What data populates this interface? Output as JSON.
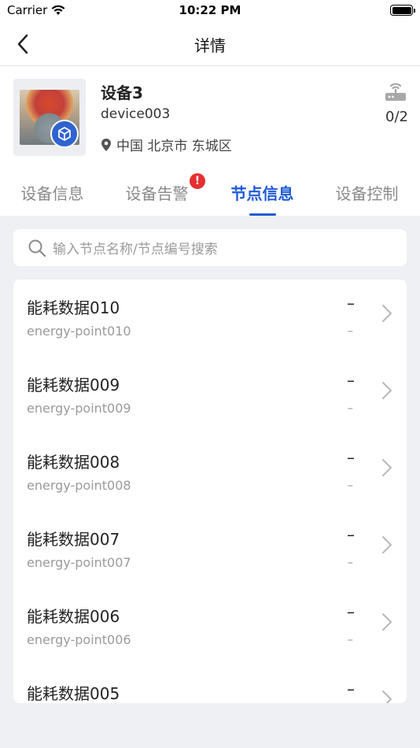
{
  "status_bar": {
    "carrier": "Carrier",
    "time": "10:22 PM"
  },
  "nav": {
    "title": "详情"
  },
  "device": {
    "name": "设备3",
    "code": "device003",
    "location": "中国 北京市 东城区",
    "node_count": "0/2"
  },
  "tabs": [
    {
      "label": "设备信息",
      "active": false
    },
    {
      "label": "设备告警",
      "active": false,
      "badge": "!"
    },
    {
      "label": "节点信息",
      "active": true
    },
    {
      "label": "设备控制",
      "active": false
    }
  ],
  "search": {
    "placeholder": "输入节点名称/节点编号搜索"
  },
  "nodes": [
    {
      "name": "能耗数据010",
      "code": "energy-point010",
      "value": "–",
      "unit": "–"
    },
    {
      "name": "能耗数据009",
      "code": "energy-point009",
      "value": "–",
      "unit": "–"
    },
    {
      "name": "能耗数据008",
      "code": "energy-point008",
      "value": "–",
      "unit": "–"
    },
    {
      "name": "能耗数据007",
      "code": "energy-point007",
      "value": "–",
      "unit": "–"
    },
    {
      "name": "能耗数据006",
      "code": "energy-point006",
      "value": "–",
      "unit": "–"
    },
    {
      "name": "能耗数据005",
      "code": "",
      "value": "–",
      "unit": ""
    }
  ],
  "colors": {
    "accent": "#1f5bd8",
    "alert": "#e53030",
    "background": "#eff0f3"
  }
}
